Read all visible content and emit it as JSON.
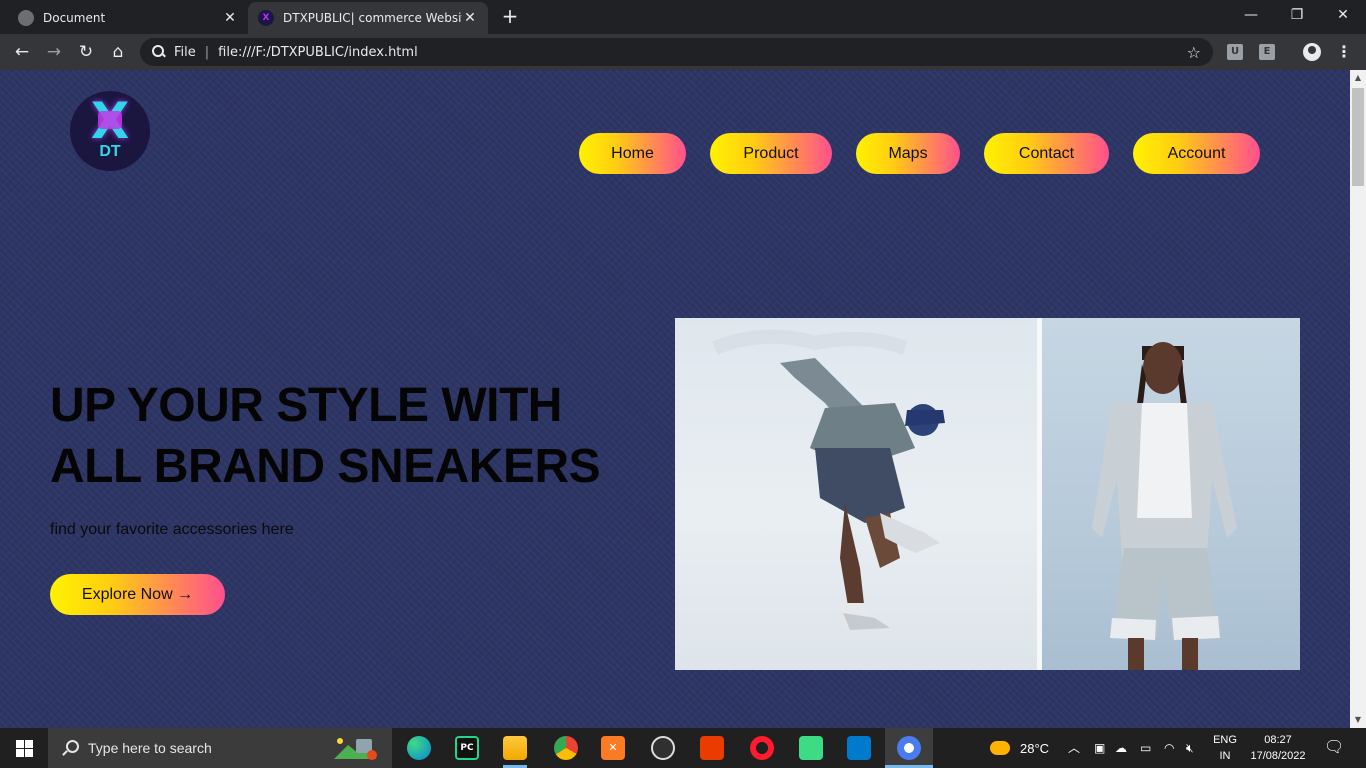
{
  "browser": {
    "tabs": [
      {
        "title": "Document",
        "state": "inactive"
      },
      {
        "title": "DTXPUBLIC| commerce Website D",
        "state": "active"
      }
    ],
    "new_tab": "+",
    "window_controls": {
      "minimize": "—",
      "restore": "❐",
      "close": "✕"
    },
    "address": {
      "scheme_label": "File",
      "url": "file:///F:/DTXPUBLIC/index.html"
    },
    "extensions": [
      "U",
      "E"
    ]
  },
  "site": {
    "logo_text": "DT",
    "logo_mark": "X",
    "nav": [
      "Home",
      "Product",
      "Maps",
      "Contact",
      "Account"
    ],
    "hero": {
      "title": "UP YOUR STYLE WITH ALL BRAND SNEAKERS",
      "subtitle": "find your favorite accessories here",
      "cta": "Explore Now →"
    },
    "colors": {
      "background": "#2d3565",
      "button_gradient_start": "#fff200",
      "button_gradient_end": "#ff4f8e"
    }
  },
  "taskbar": {
    "search_placeholder": "Type here to search",
    "apps": [
      "edge-icon",
      "pycharm-icon",
      "file-explorer-icon",
      "chrome-icon",
      "xampp-icon",
      "obs-icon",
      "office-icon",
      "opera-icon",
      "android-studio-icon",
      "vscode-icon",
      "chromium-icon"
    ],
    "weather": "28°C",
    "language_line1": "ENG",
    "language_line2": "IN",
    "time": "08:27",
    "date": "17/08/2022"
  }
}
